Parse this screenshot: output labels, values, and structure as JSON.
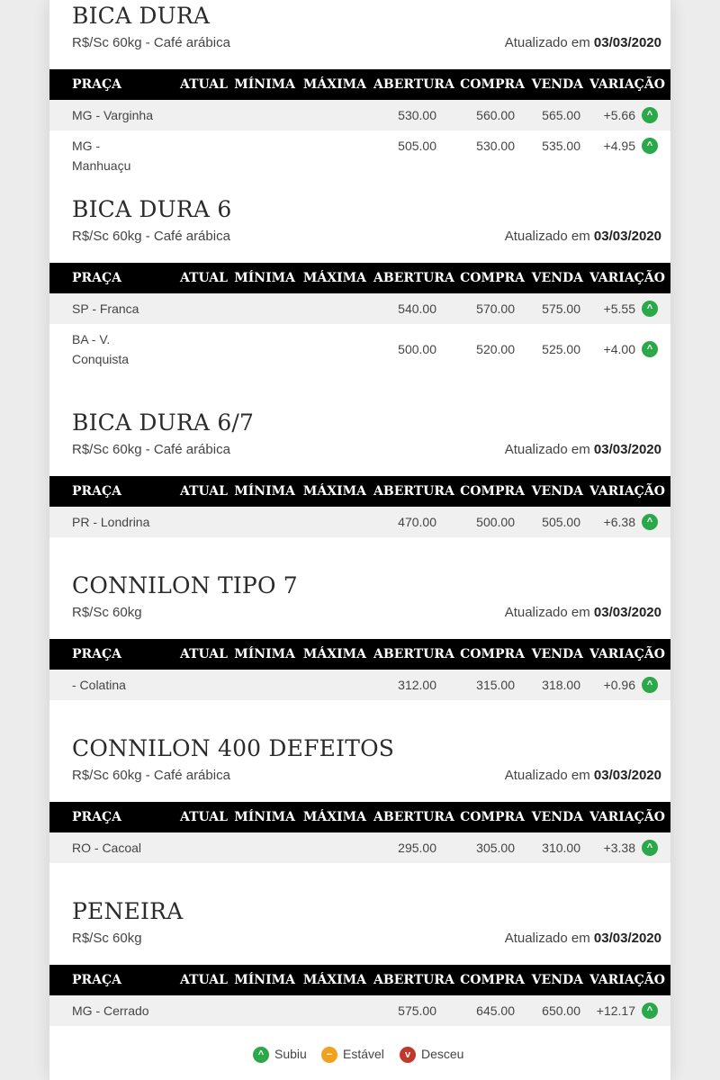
{
  "labels": {
    "updated_prefix": "Atualizado em",
    "up_glyph": "^",
    "stable_glyph": "−",
    "down_glyph": "v"
  },
  "columns": [
    "PRAÇA",
    "ATUAL",
    "MÍNIMA",
    "MÁXIMA",
    "ABERTURA",
    "COMPRA",
    "VENDA",
    "VARIAÇÃO"
  ],
  "colors": {
    "up": "#2aa84a",
    "stable": "#f0a21c",
    "down": "#c0392b",
    "header_bg": "#000000"
  },
  "sections": [
    {
      "title": "BICA DURA",
      "subtitle": "R$/Sc 60kg - Café arábica",
      "date": "03/03/2020",
      "rows": [
        {
          "place": "MG - Varginha",
          "atual": "",
          "minima": "",
          "maxima": "",
          "abertura": "530.00",
          "compra": "560.00",
          "venda": "565.00",
          "variacao": "+5.66",
          "trend": "up-icon"
        },
        {
          "place": "MG - Manhuaçu",
          "atual": "",
          "minima": "",
          "maxima": "",
          "abertura": "505.00",
          "compra": "530.00",
          "venda": "535.00",
          "variacao": "+4.95",
          "trend": "up-icon"
        }
      ]
    },
    {
      "title": "BICA DURA 6",
      "subtitle": "R$/Sc 60kg - Café arábica",
      "date": "03/03/2020",
      "rows": [
        {
          "place": "SP - Franca",
          "atual": "",
          "minima": "",
          "maxima": "",
          "abertura": "540.00",
          "compra": "570.00",
          "venda": "575.00",
          "variacao": "+5.55",
          "trend": "up-icon"
        },
        {
          "place": "BA - V. Conquista",
          "atual": "",
          "minima": "",
          "maxima": "",
          "abertura": "500.00",
          "compra": "520.00",
          "venda": "525.00",
          "variacao": "+4.00",
          "trend": "up-icon"
        }
      ]
    },
    {
      "title": "BICA DURA 6/7",
      "subtitle": "R$/Sc 60kg - Café arábica",
      "date": "03/03/2020",
      "rows": [
        {
          "place": "PR - Londrina",
          "atual": "",
          "minima": "",
          "maxima": "",
          "abertura": "470.00",
          "compra": "500.00",
          "venda": "505.00",
          "variacao": "+6.38",
          "trend": "up-icon"
        }
      ]
    },
    {
      "title": "CONNILON TIPO 7",
      "subtitle": "R$/Sc 60kg",
      "date": "03/03/2020",
      "rows": [
        {
          "place": "- Colatina",
          "atual": "",
          "minima": "",
          "maxima": "",
          "abertura": "312.00",
          "compra": "315.00",
          "venda": "318.00",
          "variacao": "+0.96",
          "trend": "up-icon"
        }
      ]
    },
    {
      "title": "CONNILON 400 DEFEITOS",
      "subtitle": "R$/Sc 60kg - Café arábica",
      "date": "03/03/2020",
      "rows": [
        {
          "place": "RO - Cacoal",
          "atual": "",
          "minima": "",
          "maxima": "",
          "abertura": "295.00",
          "compra": "305.00",
          "venda": "310.00",
          "variacao": "+3.38",
          "trend": "up-icon"
        }
      ]
    },
    {
      "title": "PENEIRA",
      "subtitle": "R$/Sc 60kg",
      "date": "03/03/2020",
      "rows": [
        {
          "place": "MG - Cerrado",
          "atual": "",
          "minima": "",
          "maxima": "",
          "abertura": "575.00",
          "compra": "645.00",
          "venda": "650.00",
          "variacao": "+12.17",
          "trend": "up-icon"
        }
      ]
    }
  ],
  "legend": [
    {
      "label": "Subiu",
      "icon": "up-icon"
    },
    {
      "label": "Estável",
      "icon": "stable-icon"
    },
    {
      "label": "Desceu",
      "icon": "down-icon"
    }
  ]
}
